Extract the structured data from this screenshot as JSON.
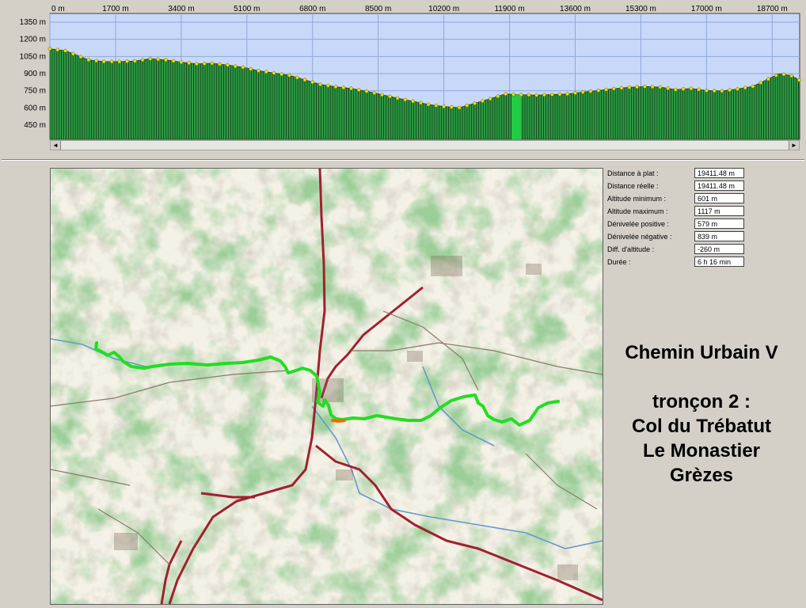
{
  "profile": {
    "x_ticks": [
      "0 m",
      "1700 m",
      "3400 m",
      "5100 m",
      "6800 m",
      "8500 m",
      "10200 m",
      "11900 m",
      "13600 m",
      "15300 m",
      "17000 m",
      "18700 m"
    ],
    "y_ticks": [
      "1350 m",
      "1200 m",
      "1050 m",
      "900 m",
      "750 m",
      "600 m",
      "450 m"
    ],
    "colors": {
      "sky": "#c8d8f8",
      "terrain": "#2e9a45",
      "terrain_dark": "#0e3c12",
      "node": "#f0e000",
      "highlight": "#22cc44"
    }
  },
  "chart_data": {
    "type": "area",
    "title": "",
    "xlabel": "",
    "ylabel": "",
    "xlim": [
      0,
      19411
    ],
    "ylim": [
      330,
      1400
    ],
    "grid": true,
    "x": [
      0,
      400,
      700,
      1000,
      1400,
      1800,
      2200,
      2600,
      3000,
      3400,
      3800,
      4200,
      4600,
      5000,
      5400,
      5800,
      6200,
      6600,
      7000,
      7400,
      7800,
      8200,
      8600,
      9000,
      9400,
      9800,
      10200,
      10600,
      11000,
      11400,
      11800,
      12200,
      12600,
      13000,
      13400,
      13800,
      14200,
      14600,
      15000,
      15400,
      15800,
      16200,
      16600,
      17000,
      17400,
      17800,
      18200,
      18600,
      18900,
      19200,
      19411
    ],
    "y": [
      1117,
      1100,
      1060,
      1020,
      1005,
      1005,
      1010,
      1030,
      1020,
      1000,
      985,
      990,
      975,
      955,
      925,
      905,
      885,
      845,
      805,
      785,
      770,
      745,
      715,
      685,
      658,
      630,
      612,
      602,
      640,
      680,
      722,
      715,
      712,
      717,
      722,
      738,
      752,
      768,
      780,
      787,
      782,
      760,
      770,
      752,
      748,
      765,
      788,
      852,
      900,
      880,
      842
    ]
  },
  "map": {
    "colors": {
      "route": "#22dd22",
      "route_hl": "#ff6600",
      "road": "#a02030",
      "river": "#6699cc"
    }
  },
  "stats": [
    {
      "label": "Distance à plat :",
      "value": "19411.48 m"
    },
    {
      "label": "Distance réelle :",
      "value": "19411.48 m"
    },
    {
      "label": "Altitude minimum :",
      "value": "601 m"
    },
    {
      "label": "Altitude maximum :",
      "value": "1117 m"
    },
    {
      "label": "Dénivelée positive :",
      "value": "579 m"
    },
    {
      "label": "Dénivelée négative :",
      "value": "839 m"
    },
    {
      "label": "Diff. d'altitude :",
      "value": "-260 m"
    },
    {
      "label": "Durée :",
      "value": "6 h 16 min"
    }
  ],
  "title": {
    "line1": "Chemin Urbain V",
    "line2": "tronçon 2 :",
    "line3": "Col du Trébatut",
    "line4": "Le Monastier",
    "line5": "Grèzes"
  }
}
